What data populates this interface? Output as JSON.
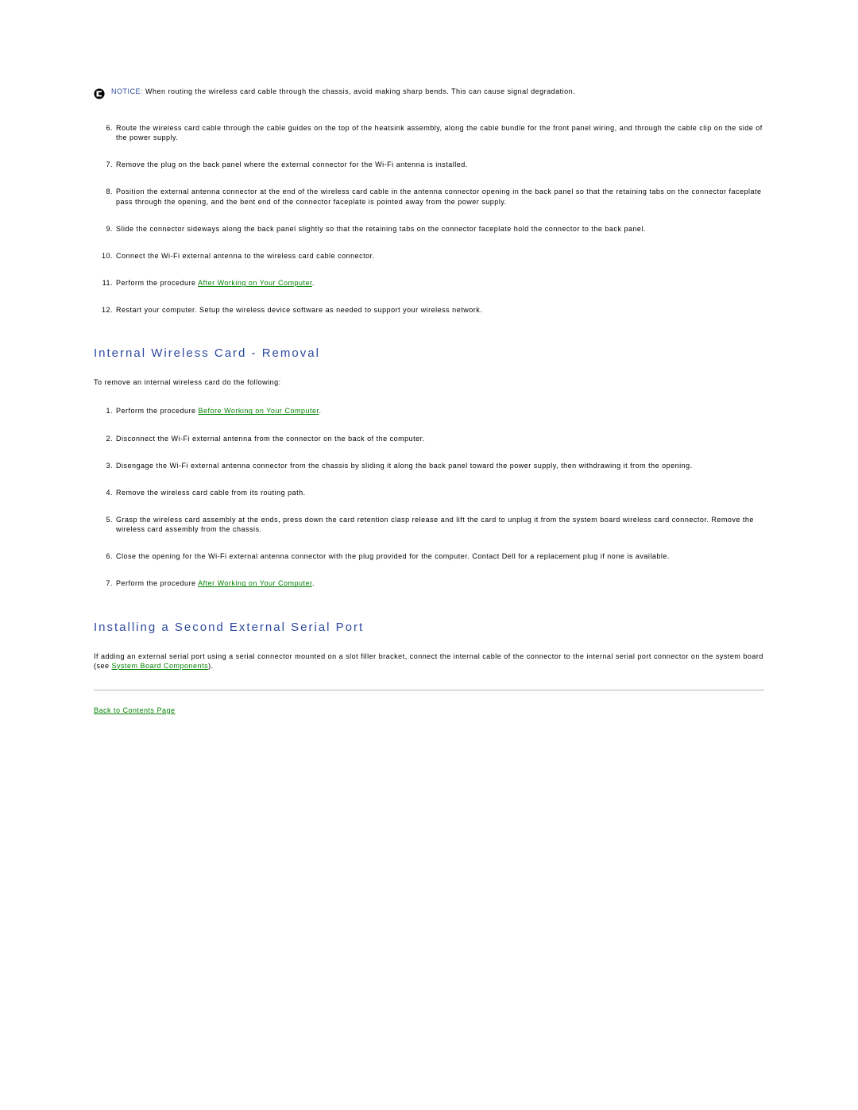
{
  "notice": {
    "label": "NOTICE:",
    "text": "When routing the wireless card cable through the chassis, avoid making sharp bends. This can cause signal degradation."
  },
  "install_steps": [
    {
      "n": "6.",
      "text": "Route the wireless card cable through the cable guides on the top of the heatsink assembly, along the cable bundle for the front panel wiring, and through the cable clip on the side of the power supply."
    },
    {
      "n": "7.",
      "text": "Remove the plug on the back panel where the external connector for the Wi-Fi antenna is installed."
    },
    {
      "n": "8.",
      "text": "Position the external antenna connector at the end of the wireless card cable in the antenna connector opening in the back panel so that the retaining tabs on the connector faceplate pass through the opening, and the bent end of the connector faceplate is pointed away from the power supply."
    },
    {
      "n": "9.",
      "text": "Slide the connector sideways along the back panel slightly so that the retaining tabs on the connector faceplate hold the connector to the back panel."
    },
    {
      "n": "10.",
      "text": "Connect the Wi-Fi external antenna to the wireless card cable connector."
    },
    {
      "n": "11.",
      "prefix": "Perform the procedure ",
      "link": "After Working on Your Computer",
      "suffix": "."
    },
    {
      "n": "12.",
      "text": "Restart your computer. Setup the wireless device software as needed to support your wireless network."
    }
  ],
  "removal": {
    "heading": "Internal Wireless Card - Removal",
    "intro": "To remove an internal wireless card do the following:",
    "steps": [
      {
        "n": "1.",
        "prefix": "Perform the procedure ",
        "link": "Before Working on Your Computer",
        "suffix": "."
      },
      {
        "n": "2.",
        "text": "Disconnect the Wi-Fi external antenna from the connector on the back of the computer."
      },
      {
        "n": "3.",
        "text": "Disengage the Wi-Fi external antenna connector from the chassis by sliding it along the back panel toward the power supply, then withdrawing it from the opening."
      },
      {
        "n": "4.",
        "text": "Remove the wireless card cable from its routing path."
      },
      {
        "n": "5.",
        "text": "Grasp the wireless card assembly at the ends, press down the card retention clasp release and lift the card to unplug it from the system board wireless card connector. Remove the wireless card assembly from the chassis."
      },
      {
        "n": "6.",
        "text": "Close the opening for the Wi-Fi external antenna connector with the plug provided for the computer. Contact Dell for a replacement plug if none is available."
      },
      {
        "n": "7.",
        "prefix": "Perform the procedure ",
        "link": "After Working on Your Computer",
        "suffix": "."
      }
    ]
  },
  "serial": {
    "heading": "Installing a Second External Serial Port",
    "para_prefix": "If adding an external serial port using a serial connector mounted on a slot filler bracket, connect the internal cable of the connector to the internal serial port connector on the system board (see ",
    "para_link": "System Board Components",
    "para_suffix": ")."
  },
  "back": "Back to Contents Page"
}
